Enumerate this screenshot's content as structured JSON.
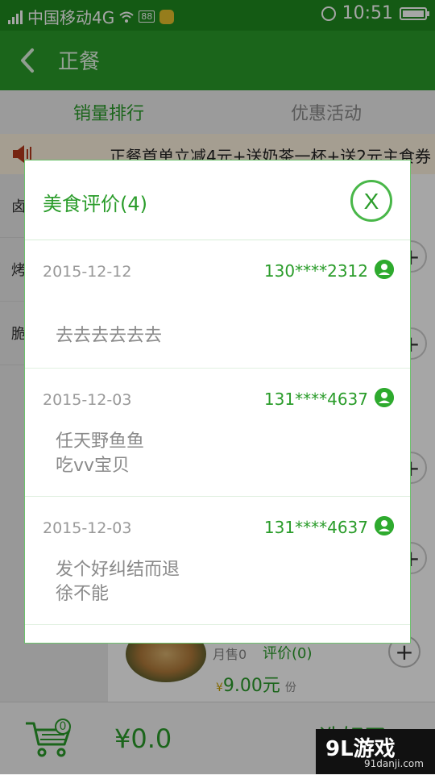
{
  "status_bar": {
    "carrier": "中国移动4G",
    "badge": "88",
    "time": "10:51"
  },
  "navbar": {
    "title": "正餐"
  },
  "tabs": [
    {
      "label": "销量排行",
      "active": true
    },
    {
      "label": "优惠活动",
      "active": false
    }
  ],
  "notice": {
    "text": "正餐首单立减4元+送奶茶一杯+送2元主食券"
  },
  "categories": [
    {
      "label": "卤"
    },
    {
      "label": "烤"
    },
    {
      "label": "脆"
    }
  ],
  "item": {
    "sold": "月售0",
    "reviews": "评价(0)",
    "price_symbol": "¥",
    "price": "9.00元",
    "unit": "份"
  },
  "bottom_bar": {
    "cart_count": "0",
    "total": "¥0.0",
    "action": "选好了"
  },
  "modal": {
    "title": "美食评价(4)",
    "close_label": "X",
    "reviews": [
      {
        "date": "2015-12-12",
        "user": "130****2312",
        "text": "去去去去去去"
      },
      {
        "date": "2015-12-03",
        "user": "131****4637",
        "text": "任天野鱼鱼\n吃vv宝贝"
      },
      {
        "date": "2015-12-03",
        "user": "131****4637",
        "text": "发个好纠结而退\n徐不能"
      }
    ]
  },
  "watermark": {
    "main": "9L游戏",
    "sub": "91danji.com"
  },
  "colors": {
    "primary_green": "#2a9c2a",
    "status_green": "#1f8a1f",
    "notice_bg": "#fdf3df"
  }
}
